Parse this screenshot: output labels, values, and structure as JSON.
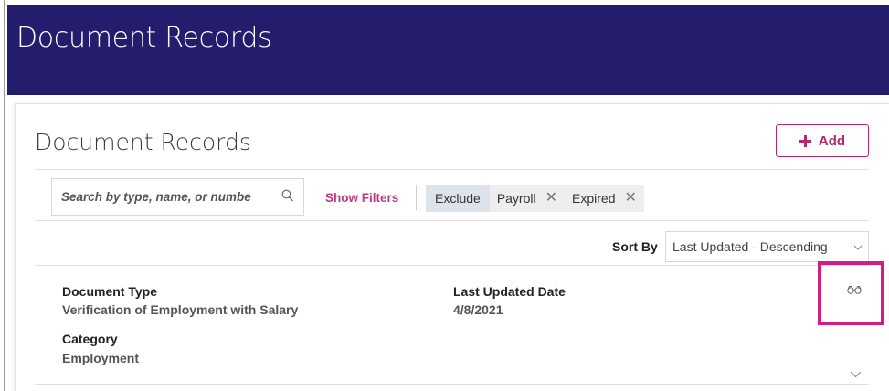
{
  "banner": {
    "title": "Document Records"
  },
  "card": {
    "title": "Document Records",
    "add_label": "Add"
  },
  "search": {
    "placeholder": "Search by type, name, or numbe"
  },
  "filters": {
    "show_label": "Show Filters",
    "exclude_label": "Exclude",
    "chips": [
      "Payroll",
      "Expired"
    ]
  },
  "sort": {
    "label": "Sort By",
    "value": "Last Updated - Descending"
  },
  "record": {
    "doc_type_label": "Document Type",
    "doc_type_value": "Verification of Employment with Salary",
    "updated_label": "Last Updated Date",
    "updated_value": "4/8/2021",
    "category_label": "Category",
    "category_value": "Employment"
  },
  "icons": {
    "add": "plus-icon",
    "search": "search-icon",
    "remove_chip": "close-icon",
    "sort": "chevron-down-icon",
    "view": "glasses-icon",
    "expand": "chevron-down-icon"
  },
  "colors": {
    "banner": "#241d6e",
    "accent": "#b5266e",
    "highlight": "#d11d86"
  }
}
